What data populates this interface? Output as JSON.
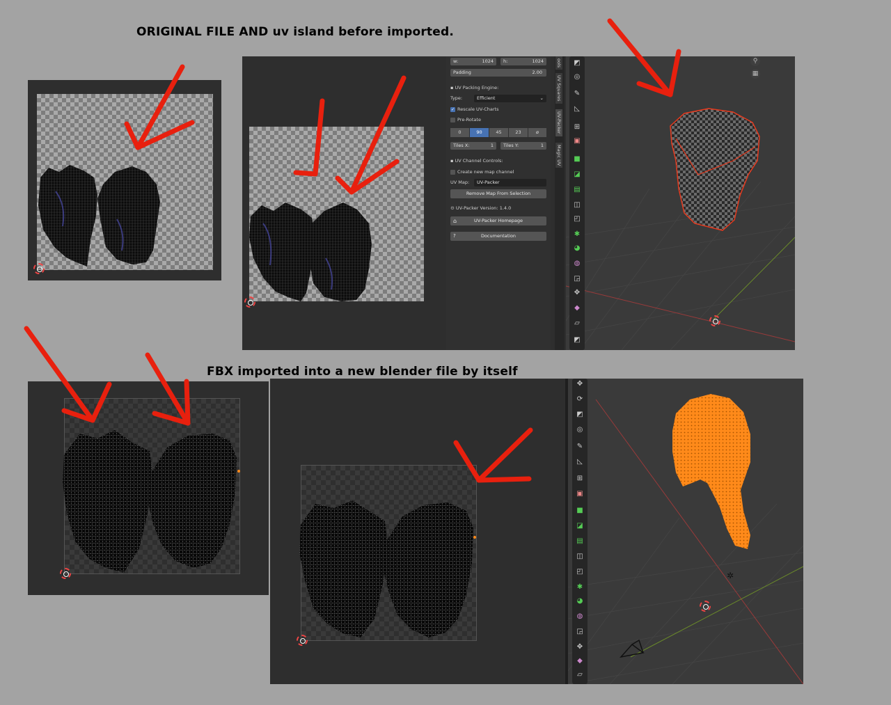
{
  "headings": {
    "top": "ORIGINAL FILE AND  uv island before imported.",
    "bottom": "FBX imported into a new  blender file by itself"
  },
  "uv_packer_panel": {
    "w_label": "w:",
    "w_value": "1024",
    "h_label": "h:",
    "h_value": "1024",
    "padding_label": "Padding",
    "padding_value": "2.00",
    "engine_section": "UV Packing Engine:",
    "type_label": "Type:",
    "type_value": "Efficient",
    "rescale_label": "Rescale UV-Charts",
    "rescale_checked": true,
    "prerotate_label": "Pre-Rotate",
    "prerotate_checked": false,
    "rotations": [
      "0",
      "90",
      "45",
      "23",
      "ø"
    ],
    "rotation_selected": "90",
    "tiles_x_label": "Tiles X:",
    "tiles_x_value": "1",
    "tiles_y_label": "Tiles Y:",
    "tiles_y_value": "1",
    "channel_section": "UV Channel Controls:",
    "create_map_label": "Create new map channel",
    "uvmap_label": "UV Map:",
    "uvmap_value": "UV-Packer",
    "remove_map_button": "Remove Map From Selection",
    "version_text": "UV-Packer Version: 1.4.0",
    "homepage_button": "UV-Packer Homepage",
    "documentation_button": "Documentation"
  },
  "side_tabs": [
    "ools",
    "UV Squares",
    "UV-Packer",
    "Magic UV"
  ],
  "colors": {
    "arrow": "#e8200e",
    "selected_outline": "#e83a1e",
    "mesh_orange": "#ff8a1a",
    "accent_blue": "#4772b3"
  },
  "icons": {
    "tool_icons_top": [
      "frame-icon",
      "transform-icon",
      "annotate-icon",
      "measure-icon",
      "add-cube-icon",
      "extrude-icon",
      "inset-icon",
      "bevel-icon",
      "loopcut-icon",
      "knife-icon",
      "polybuild-icon",
      "spin-icon",
      "smooth-icon",
      "shrink-icon",
      "shear-icon",
      "tosphere-icon",
      "rip-icon",
      "cube-icon"
    ],
    "tool_icons_bottom": [
      "move-icon",
      "rotate-icon",
      "scale-icon",
      "transform-icon",
      "annotate-icon",
      "measure-icon",
      "add-cube-icon",
      "extrude-icon",
      "inset-icon",
      "bevel-icon",
      "loopcut-icon",
      "knife-icon",
      "polybuild-icon",
      "spin-icon",
      "smooth-icon",
      "shrink-icon",
      "shear-icon",
      "tosphere-icon",
      "rip-icon"
    ]
  }
}
